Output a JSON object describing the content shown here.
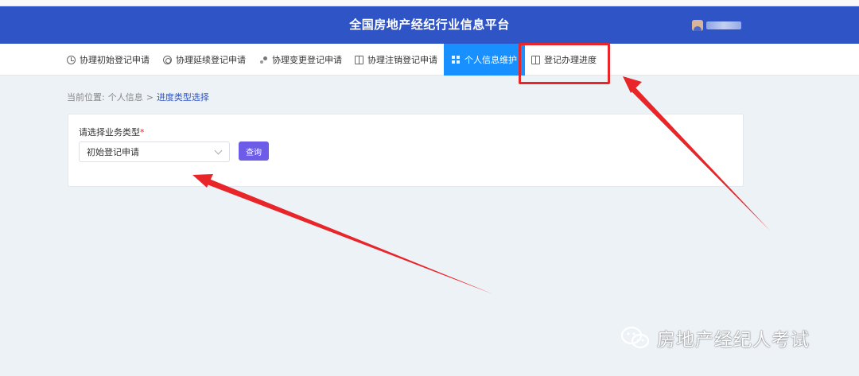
{
  "header": {
    "title": "全国房地产经纪行业信息平台",
    "brand_color": "#2f54c6"
  },
  "nav": {
    "items": [
      {
        "label": "协理初始登记申请",
        "icon": "clock-icon"
      },
      {
        "label": "协理延续登记申请",
        "icon": "target-icon"
      },
      {
        "label": "协理变更登记申请",
        "icon": "dots-icon"
      },
      {
        "label": "协理注销登记申请",
        "icon": "book-icon"
      },
      {
        "label": "个人信息维护",
        "icon": "grid-icon",
        "active": true
      },
      {
        "label": "登记办理进度",
        "icon": "book-icon"
      }
    ],
    "active_color": "#1890ff"
  },
  "breadcrumb": {
    "prefix": "当前位置:",
    "parent": "个人信息",
    "separator": ">",
    "current": "进度类型选择"
  },
  "form": {
    "label": "请选择业务类型",
    "required_mark": "*",
    "select_value": "初始登记申请",
    "query_button": "查询",
    "button_color": "#6c5ce7"
  },
  "annotation": {
    "color": "#e8262a"
  },
  "watermark": {
    "text": "房地产经纪人考试",
    "icon": "wechat-icon"
  }
}
